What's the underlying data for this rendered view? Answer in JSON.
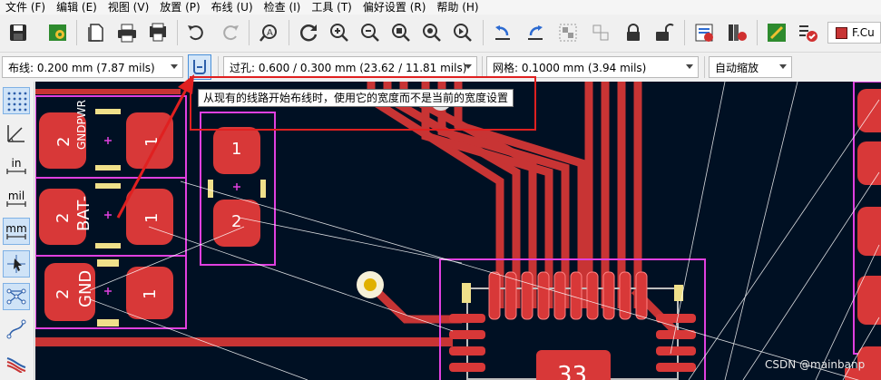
{
  "menu": [
    {
      "label": "文件 (F)"
    },
    {
      "label": "编辑 (E)"
    },
    {
      "label": "视图 (V)"
    },
    {
      "label": "放置 (P)"
    },
    {
      "label": "布线 (U)"
    },
    {
      "label": "检查 (I)"
    },
    {
      "label": "工具 (T)"
    },
    {
      "label": "偏好设置 (R)"
    },
    {
      "label": "帮助 (H)"
    }
  ],
  "toolbar": {
    "buttons": [
      "save-icon",
      "board-setup-icon",
      "page-icon",
      "print-icon",
      "plot-icon",
      "undo-icon",
      "redo-icon",
      "find-icon",
      "refresh-icon",
      "zoom-in-icon",
      "zoom-out-icon",
      "zoom-fit-icon",
      "zoom-objects-icon",
      "zoom-selection-icon",
      "rotate-ccw-icon",
      "rotate-cw-icon",
      "group-icon",
      "ungroup-icon",
      "lock-icon",
      "unlock-icon",
      "netlist-icon",
      "library-icon",
      "scripting-icon",
      "drc-icon"
    ],
    "layer_name": "F.Cu",
    "layer_color": "#c83434"
  },
  "toolbar2": {
    "track_width": "布线: 0.200 mm (7.87 mils)",
    "via_size": "过孔: 0.600 / 0.300 mm (23.62 / 11.81 mils)",
    "grid": "网格: 0.1000 mm (3.94 mils)",
    "zoom": "自动缩放"
  },
  "left_toolbar": {
    "buttons": [
      "grid-dots-icon",
      "polar-coords-icon",
      "inches-icon",
      "mils-icon",
      "millimeters-icon",
      "cursor-icon",
      "ratsnest-icon",
      "curved-ratsnest-icon",
      "tracks-icon"
    ],
    "in_label": "in",
    "mil_label": "mil",
    "mm_label": "mm"
  },
  "tooltip": {
    "text": "从现有的线路开始布线时，使用它的宽度而不是当前的宽度设置"
  },
  "pcb": {
    "pad_labels": [
      "2",
      "1",
      "2",
      "1",
      "2",
      "1",
      "1",
      "2"
    ],
    "net_labels": [
      "GNDPWR",
      "BAT-",
      "GND"
    ],
    "ic_number": "33",
    "colors": {
      "board": "#001023",
      "copper": "#c83434",
      "silkscreen": "#e040e0",
      "pad": "#d83838",
      "ratsnest": "#ffffff",
      "via": "#f0c800"
    }
  },
  "watermark": "CSDN @mainbanp"
}
